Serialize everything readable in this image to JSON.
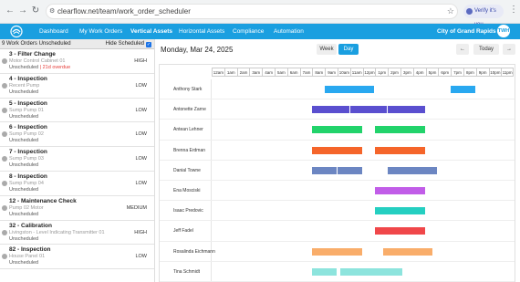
{
  "browser": {
    "url": "clearflow.net/team/work_order_scheduler",
    "verify_label": "Verify it's you"
  },
  "header": {
    "nav": [
      "Dashboard",
      "My Work Orders",
      "Vertical Assets",
      "Horizontal Assets",
      "Compliance",
      "Automation"
    ],
    "active_nav": "Vertical Assets",
    "location": "City of Grand Rapids",
    "avatar_initials": "TWH"
  },
  "left": {
    "count_label": "9 Work Orders Unscheduled",
    "hide_scheduled_label": "Hide Scheduled",
    "work_orders": [
      {
        "title": "3 - Filter Change",
        "asset": "Motor Control Cabinet 01",
        "status": "Unscheduled",
        "overdue": "21d overdue",
        "priority": "HIGH"
      },
      {
        "title": "4 - Inspection",
        "asset": "Recent Pump",
        "status": "Unscheduled",
        "overdue": "",
        "priority": "LOW"
      },
      {
        "title": "5 - Inspection",
        "asset": "Sump Pump 01",
        "status": "Unscheduled",
        "overdue": "",
        "priority": "LOW"
      },
      {
        "title": "6 - Inspection",
        "asset": "Sump Pump 02",
        "status": "Unscheduled",
        "overdue": "",
        "priority": "LOW"
      },
      {
        "title": "7 - Inspection",
        "asset": "Sump Pump 03",
        "status": "Unscheduled",
        "overdue": "",
        "priority": "LOW"
      },
      {
        "title": "8 - Inspection",
        "asset": "Sump Pump 04",
        "status": "Unscheduled",
        "overdue": "",
        "priority": "LOW"
      },
      {
        "title": "12 - Maintenance Check",
        "asset": "Pump 02 Motor",
        "status": "Unscheduled",
        "overdue": "",
        "priority": "MEDIUM"
      },
      {
        "title": "32 - Calibration",
        "asset": "Livingston - Level Indicating Transmitter 01",
        "status": "Unscheduled",
        "overdue": "",
        "priority": "HIGH"
      },
      {
        "title": "82 - Inspection",
        "asset": "House Panel 01",
        "status": "Unscheduled",
        "overdue": "",
        "priority": "LOW"
      }
    ]
  },
  "right": {
    "date": "Monday, Mar 24, 2025",
    "week_label": "Week",
    "day_label": "Day",
    "prev_label": "←",
    "today_label": "Today",
    "next_label": "→",
    "hours": [
      "12am",
      "1am",
      "2am",
      "3am",
      "4am",
      "5am",
      "6am",
      "7am",
      "8am",
      "9am",
      "10am",
      "11am",
      "12pm",
      "1pm",
      "2pm",
      "3pm",
      "4pm",
      "5pm",
      "6pm",
      "7pm",
      "8pm",
      "9pm",
      "10pm",
      "11pm"
    ],
    "technicians": [
      {
        "name": "Anthony Stark",
        "blocks": [
          {
            "start": 9,
            "end": 13,
            "color": "#29a8f0"
          },
          {
            "start": 19,
            "end": 21,
            "color": "#29a8f0"
          }
        ]
      },
      {
        "name": "Antonette Zarne",
        "blocks": [
          {
            "start": 8,
            "end": 11,
            "color": "#5a4fcf"
          },
          {
            "start": 11,
            "end": 14,
            "color": "#5a4fcf"
          },
          {
            "start": 14,
            "end": 17,
            "color": "#5a4fcf"
          }
        ]
      },
      {
        "name": "Antean Lehner",
        "blocks": [
          {
            "start": 8,
            "end": 12,
            "color": "#22d36b"
          },
          {
            "start": 13,
            "end": 17,
            "color": "#22d36b"
          }
        ]
      },
      {
        "name": "Brenna Erdman",
        "blocks": [
          {
            "start": 8,
            "end": 12,
            "color": "#f5652a"
          },
          {
            "start": 13,
            "end": 17,
            "color": "#f5652a"
          }
        ]
      },
      {
        "name": "Danial Towne",
        "blocks": [
          {
            "start": 8,
            "end": 10,
            "color": "#6c86c2"
          },
          {
            "start": 10,
            "end": 12,
            "color": "#6c86c2"
          },
          {
            "start": 14,
            "end": 18,
            "color": "#6c86c2"
          }
        ]
      },
      {
        "name": "Ena Mosciski",
        "blocks": [
          {
            "start": 13,
            "end": 17,
            "color": "#c15de8"
          }
        ]
      },
      {
        "name": "Isaac Predovic",
        "blocks": [
          {
            "start": 13,
            "end": 17,
            "color": "#25cfc1"
          }
        ]
      },
      {
        "name": "Jeff Fadel",
        "blocks": [
          {
            "start": 13,
            "end": 17,
            "color": "#f0474a"
          }
        ]
      },
      {
        "name": "Rosalinda Eichmann",
        "blocks": [
          {
            "start": 8,
            "end": 12,
            "color": "#f9ad6a"
          },
          {
            "start": 13.6,
            "end": 17.6,
            "color": "#f9ad6a"
          }
        ]
      },
      {
        "name": "Tina Schmidt",
        "blocks": [
          {
            "start": 8,
            "end": 10,
            "color": "#8de4dd"
          },
          {
            "start": 10.2,
            "end": 15.2,
            "color": "#8de4dd"
          }
        ]
      }
    ]
  }
}
